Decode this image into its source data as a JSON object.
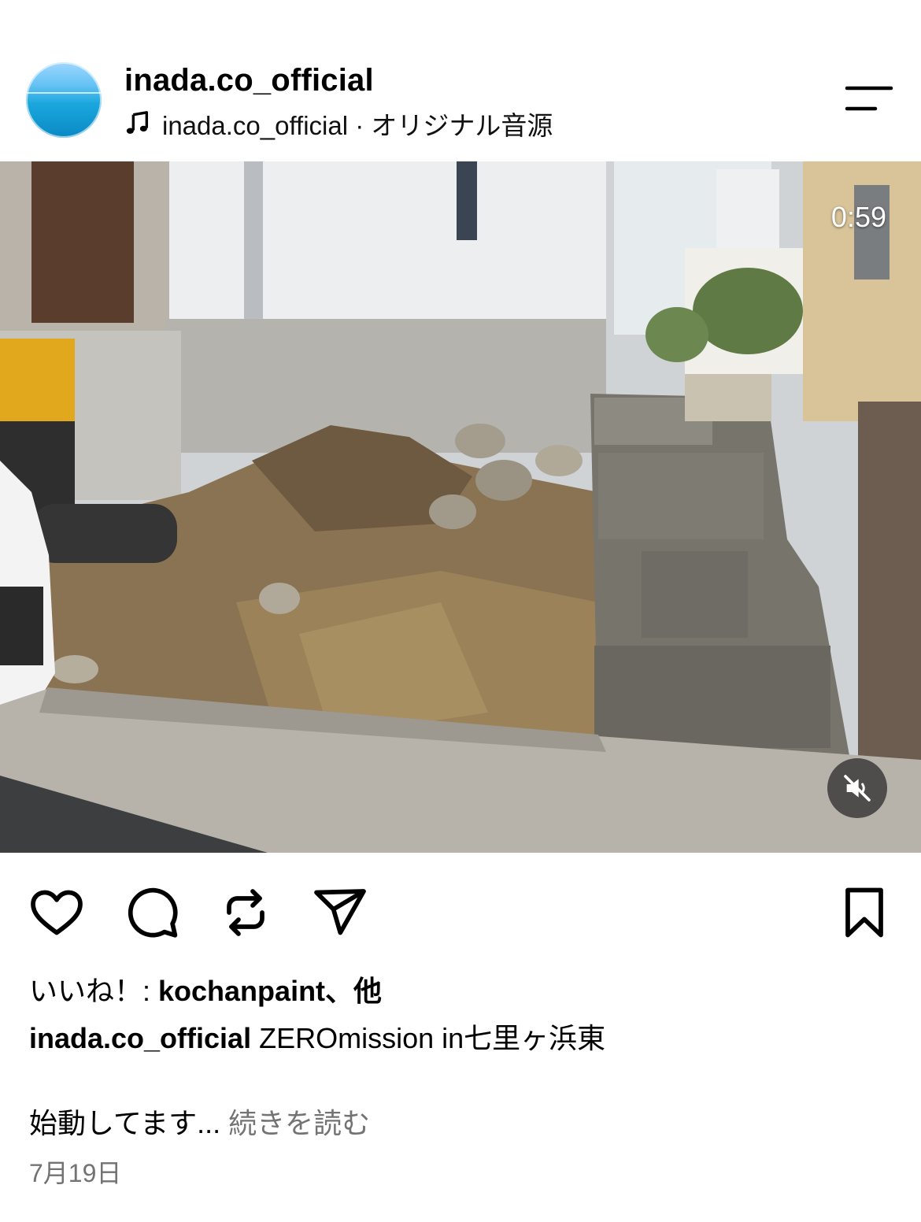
{
  "post": {
    "username": "inada.co_official",
    "audio": "inada.co_official · オリジナル音源",
    "video_timer": "0:59",
    "likes_prefix": "いいね！: ",
    "likes_user": "kochanpaint",
    "likes_suffix": "、他",
    "caption_user": "inada.co_official",
    "caption_text": " ZEROmission in七里ヶ浜東",
    "caption_line2": "始動してます... ",
    "more_label": "続きを読む",
    "date": "7月19日"
  },
  "icons": {
    "avatar": "ocean-avatar",
    "music": "music-note-icon",
    "menu": "menu-icon",
    "mute": "muted-speaker-icon",
    "like": "heart-icon",
    "comment": "comment-icon",
    "repost": "repost-icon",
    "share": "send-icon",
    "save": "bookmark-icon"
  },
  "colors": {
    "text": "#000000",
    "secondary_text": "#737373"
  }
}
